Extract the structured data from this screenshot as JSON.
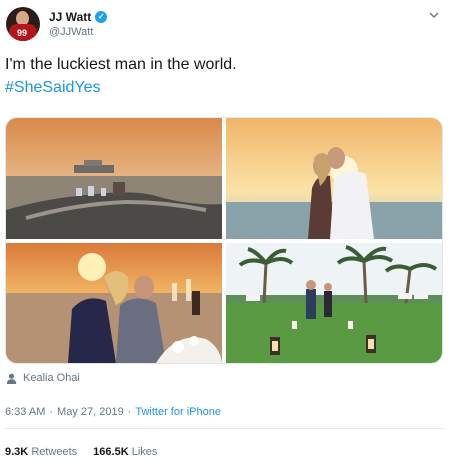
{
  "author": {
    "display_name": "JJ Watt",
    "handle": "@JJWatt",
    "avatar_number": "99",
    "verified_icon": "verified-badge-icon"
  },
  "tweet": {
    "text": "I'm the luckiest man in the world.",
    "hashtag": "#SheSaidYes"
  },
  "media": {
    "photos": [
      "sunset-yacht-pier",
      "couple-kiss-sunset",
      "couple-embrace-champagne",
      "lawn-lanterns-palms"
    ]
  },
  "tag": {
    "icon": "person-icon",
    "name": "Kealia Ohai"
  },
  "meta": {
    "time": "6:33 AM",
    "separator1": "·",
    "date": "May 27, 2019",
    "separator2": "·",
    "source": "Twitter for iPhone"
  },
  "stats": {
    "retweets_count": "9.3K",
    "retweets_label": "Retweets",
    "likes_count": "166.5K",
    "likes_label": "Likes"
  },
  "colors": {
    "link": "#1b95e0",
    "verified": "#1da1f2",
    "secondary_text": "#657786",
    "primary_text": "#14171a"
  }
}
